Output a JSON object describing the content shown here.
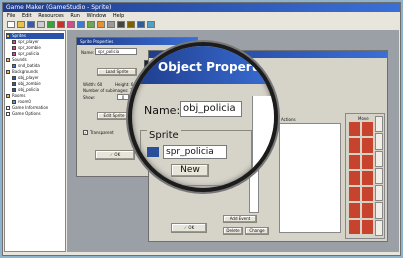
{
  "app": {
    "title": "Game Maker (GameStudio - Sprite)",
    "menu": [
      "File",
      "Edit",
      "Resources",
      "Run",
      "Window",
      "Help"
    ]
  },
  "toolbar": {
    "icons": [
      "new",
      "open",
      "save",
      "cut",
      "copy",
      "paste",
      "run",
      "run-debug",
      "add-sprite",
      "add-sound",
      "add-background",
      "add-path",
      "add-script",
      "add-font",
      "add-timeline",
      "add-object",
      "add-room"
    ]
  },
  "resource_tree": {
    "items": [
      {
        "label": "Sprites",
        "type": "folder",
        "selected": true
      },
      {
        "label": "spr_player",
        "type": "sprite"
      },
      {
        "label": "spr_zombie",
        "type": "sprite"
      },
      {
        "label": "spr_policia",
        "type": "sprite"
      },
      {
        "label": "Sounds",
        "type": "folder"
      },
      {
        "label": "snd_batida",
        "type": "sound"
      },
      {
        "label": "Backgrounds",
        "type": "folder"
      },
      {
        "label": "obj_player",
        "type": "object"
      },
      {
        "label": "obj_zombie",
        "type": "object"
      },
      {
        "label": "obj_policia",
        "type": "object"
      },
      {
        "label": "Rooms",
        "type": "folder"
      },
      {
        "label": "room0",
        "type": "room"
      },
      {
        "label": "Game Information",
        "type": "item"
      },
      {
        "label": "Game Options",
        "type": "item"
      }
    ]
  },
  "sprite_window": {
    "title": "Sprite Properties",
    "name_label": "Name:",
    "name_value": "spr_policia",
    "load_button": "Load Sprite",
    "width_text": "Width: 60",
    "height_text": "Height: 60",
    "subimages_text": "Number of subimages: 72",
    "show_label": "Show:",
    "show_value": "0",
    "edit_button": "Edit Sprite",
    "transparent_label": "Transparent",
    "ok_button": "OK"
  },
  "object_window": {
    "title": "Object Properties",
    "name_label": "Name:",
    "name_value": "obj_policia",
    "sprite_group_label": "Sprite",
    "sprite_value": "spr_policia",
    "new_button": "New",
    "actions_header": "Actions",
    "add_event_button": "Add Event",
    "delete_button": "Delete",
    "change_button": "Change",
    "ok_button": "OK",
    "right_tabs": [
      "move",
      "main1",
      "main2",
      "control",
      "score",
      "extra",
      "draw"
    ],
    "side_labels": [
      "Move",
      "Jump",
      "Paths",
      "Steps"
    ]
  },
  "colors": {
    "titlebar": "#1f3d8c",
    "desktop": "#8fb3cc",
    "panel": "#d6d3c9",
    "tab_red": "#c8432e"
  }
}
